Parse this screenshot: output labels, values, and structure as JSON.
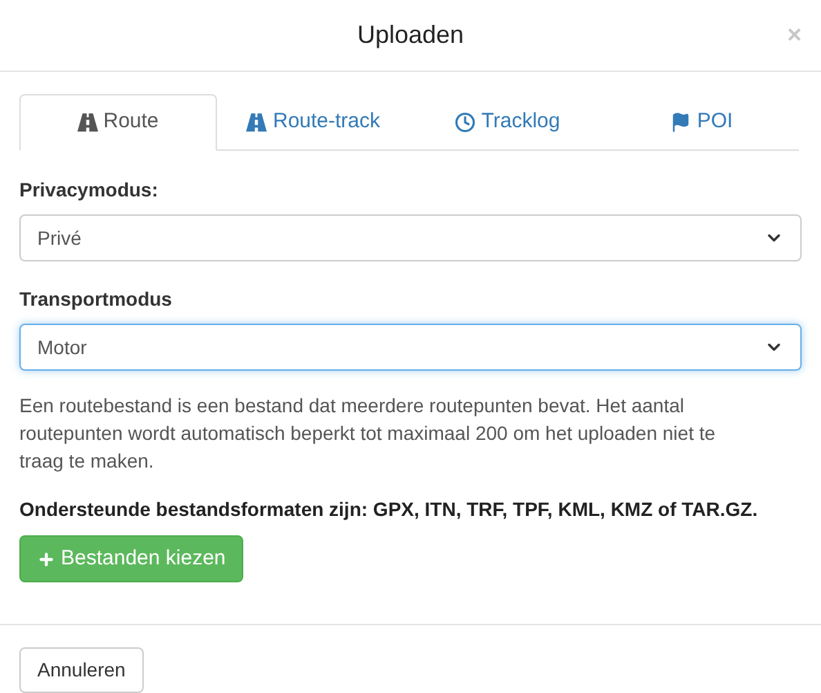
{
  "dialog": {
    "title": "Uploaden",
    "close": "×"
  },
  "tabs": [
    {
      "label": "Route",
      "selected": true
    },
    {
      "label": "Route-track",
      "selected": false
    },
    {
      "label": "Tracklog",
      "selected": false
    },
    {
      "label": "POI",
      "selected": false
    }
  ],
  "fields": [
    {
      "label": "Privacymodus:",
      "value": "Privé",
      "focused": false
    },
    {
      "label": "Transportmodus",
      "value": "Motor",
      "focused": true
    }
  ],
  "description": "Een routebestand is een bestand dat meerdere routepunten bevat. Het aantal routepunten wordt automatisch beperkt tot maximaal 200 om het uploaden niet te traag te maken.",
  "formats_note": "Ondersteunde bestandsformaten zijn: GPX, ITN, TRF, TPF, KML, KMZ of TAR.GZ.",
  "choose_button": {
    "label": "Bestanden kiezen"
  },
  "footer": {
    "cancel": "Annuleren"
  }
}
